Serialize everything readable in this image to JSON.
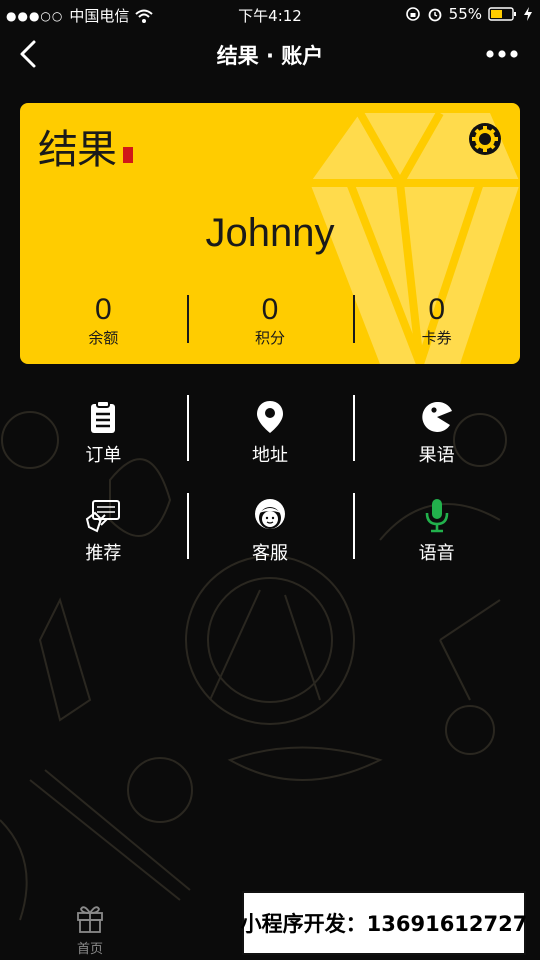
{
  "status_bar": {
    "carrier": "中国电信",
    "time": "下午4:12",
    "battery": "55%"
  },
  "nav": {
    "title": "结果 · 账户"
  },
  "card": {
    "brand": "结果",
    "username": "Johnny",
    "stats": [
      {
        "value": "0",
        "label": "余额"
      },
      {
        "value": "0",
        "label": "积分"
      },
      {
        "value": "0",
        "label": "卡券"
      }
    ]
  },
  "menu": [
    {
      "label": "订单",
      "icon": "clipboard-icon"
    },
    {
      "label": "地址",
      "icon": "location-pin-icon"
    },
    {
      "label": "果语",
      "icon": "pacman-icon"
    },
    {
      "label": "推荐",
      "icon": "recommend-card-icon"
    },
    {
      "label": "客服",
      "icon": "support-agent-icon"
    },
    {
      "label": "语音",
      "icon": "microphone-icon"
    }
  ],
  "tabbar": {
    "home_label": "首页"
  },
  "promo": {
    "text": "小程序开发：13691612727"
  },
  "colors": {
    "card": "#ffcc00",
    "background": "#0b0b0b",
    "mic": "#22b14c"
  }
}
